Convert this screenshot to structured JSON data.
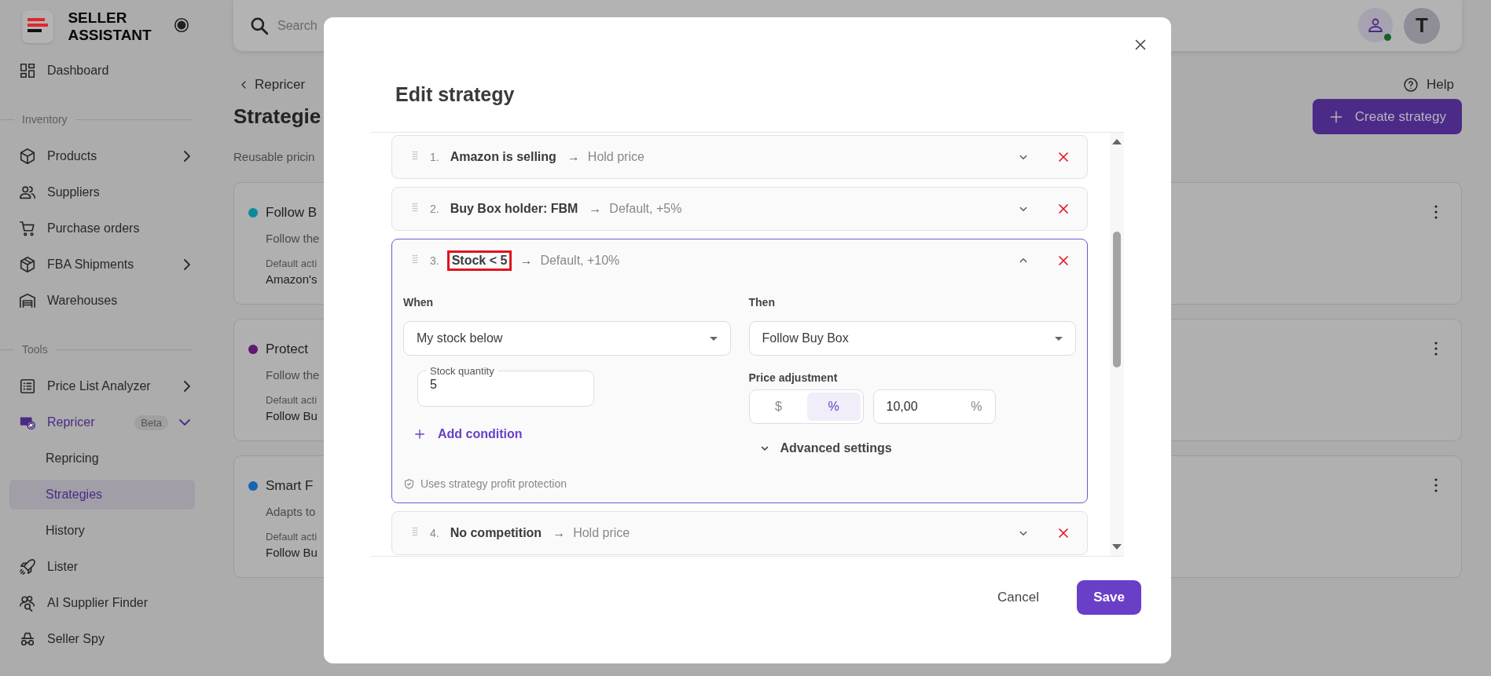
{
  "sidebar": {
    "brand": "SELLER ASSISTANT",
    "nav": [
      {
        "kind": "item",
        "label": "Dashboard",
        "selected": false,
        "has_submenu": false
      },
      {
        "kind": "section",
        "label": "Inventory"
      },
      {
        "kind": "item",
        "label": "Products",
        "selected": false,
        "has_submenu": true
      },
      {
        "kind": "item",
        "label": "Suppliers",
        "selected": false,
        "has_submenu": false
      },
      {
        "kind": "item",
        "label": "Purchase orders",
        "selected": false,
        "has_submenu": false
      },
      {
        "kind": "item",
        "label": "FBA Shipments",
        "selected": false,
        "has_submenu": true
      },
      {
        "kind": "item",
        "label": "Warehouses",
        "selected": false,
        "has_submenu": false
      },
      {
        "kind": "section",
        "label": "Tools"
      },
      {
        "kind": "item",
        "label": "Price List Analyzer",
        "selected": false,
        "has_submenu": true
      },
      {
        "kind": "item",
        "label": "Repricer",
        "selected": true,
        "badge": "Beta",
        "expanded": true,
        "children": [
          {
            "label": "Repricing",
            "selected": false
          },
          {
            "label": "Strategies",
            "selected": true
          },
          {
            "label": "History",
            "selected": false
          }
        ]
      },
      {
        "kind": "item",
        "label": "Lister",
        "selected": false,
        "has_submenu": false
      },
      {
        "kind": "item",
        "label": "AI Supplier Finder",
        "selected": false,
        "has_submenu": false
      },
      {
        "kind": "item",
        "label": "Seller Spy",
        "selected": false,
        "has_submenu": false
      }
    ]
  },
  "topbar": {
    "search": {
      "placeholder": "Search"
    },
    "user_online": true,
    "avatar": "T"
  },
  "page": {
    "back": "Repricer",
    "title": "Strategie",
    "subtitle": "Reusable pricin",
    "help": "Help",
    "create_button": "Create strategy",
    "cards": [
      {
        "color": "#0b8a9a",
        "name": "Follow B",
        "description": "Follow the",
        "default_label": "Default acti",
        "default_value": "Amazon's"
      },
      {
        "color": "#5e1a72",
        "name": "Protect",
        "description": "Follow the",
        "default_label": "Default acti",
        "default_value": "Follow Bu"
      },
      {
        "color": "#1565b0",
        "name": "Smart F",
        "description": "Adapts to",
        "default_label": "Default acti",
        "default_value": "Follow Bu"
      }
    ]
  },
  "modal": {
    "title": "Edit strategy",
    "rules": [
      {
        "number": "1.",
        "condition": "Amazon is selling",
        "arrow": "→",
        "action": "Hold price",
        "expanded": false,
        "highlighted": false
      },
      {
        "number": "2.",
        "condition": "Buy Box holder: FBM",
        "arrow": "→",
        "action": "Default, +5%",
        "expanded": false,
        "highlighted": false
      },
      {
        "number": "3.",
        "condition": "Stock < 5",
        "arrow": "→",
        "action": "Default, +10%",
        "expanded": true,
        "highlighted": true,
        "detail": {
          "when_label": "When",
          "condition_select": "My stock below",
          "field": {
            "label": "Stock quantity",
            "value": "5"
          },
          "add_condition": "Add condition",
          "then_label": "Then",
          "action_select": "Follow Buy Box",
          "adjustment_label": "Price adjustment",
          "units": [
            {
              "label": "$",
              "selected": false
            },
            {
              "label": "%",
              "selected": true
            }
          ],
          "amount": {
            "value": "10,00",
            "suffix": "%"
          },
          "advanced": "Advanced settings",
          "note": "Uses strategy profit protection"
        }
      },
      {
        "number": "4.",
        "condition": "No competition",
        "arrow": "→",
        "action": "Hold price",
        "expanded": false,
        "highlighted": false
      }
    ],
    "cancel": "Cancel",
    "save": "Save"
  }
}
